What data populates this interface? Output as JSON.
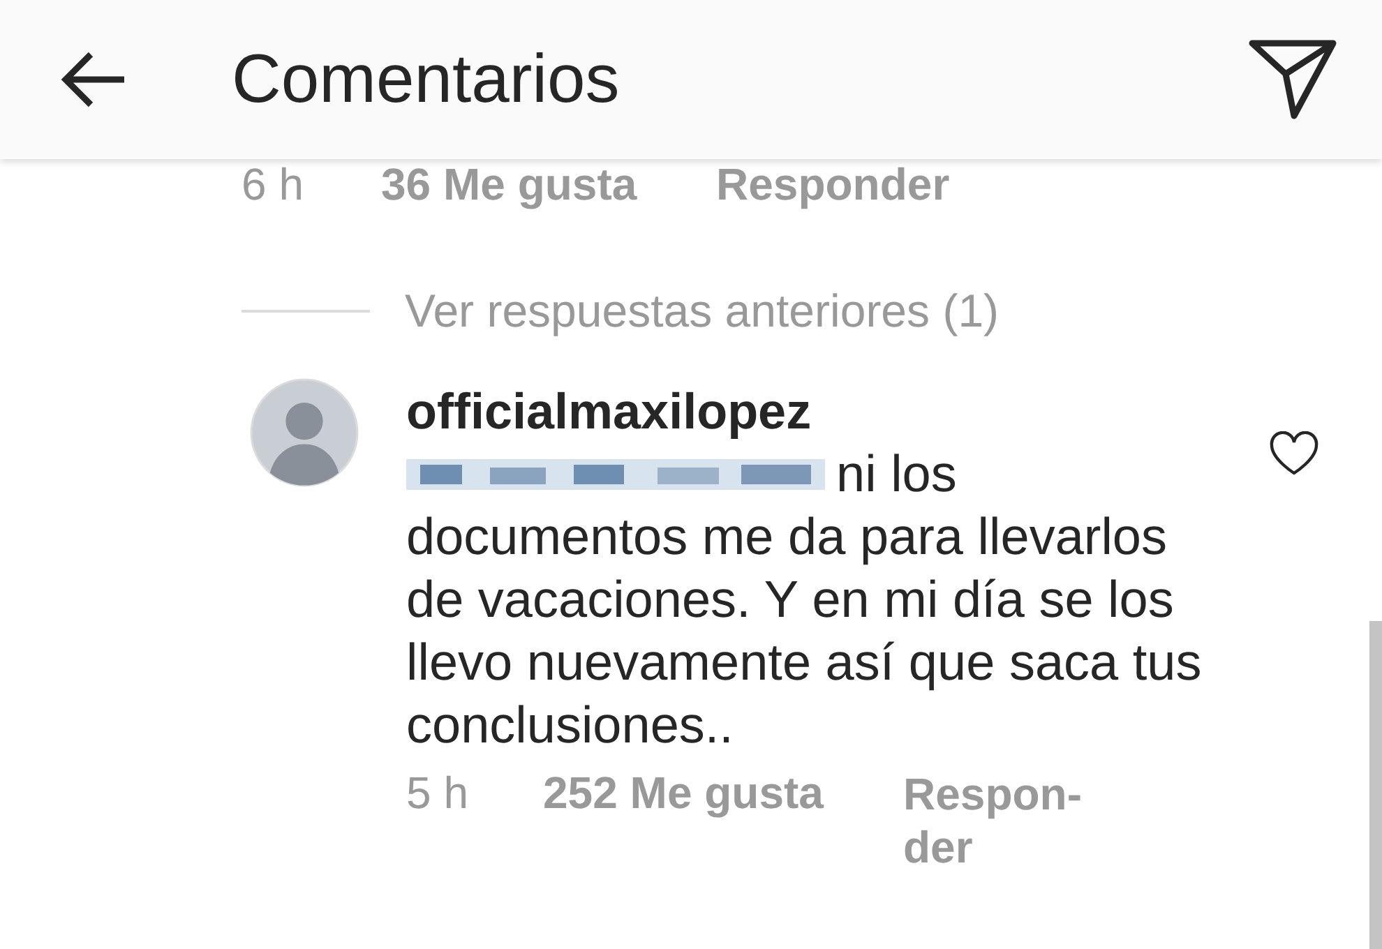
{
  "header": {
    "title": "Comentarios"
  },
  "previous_comment": {
    "time": "6 h",
    "likes": "36 Me gusta",
    "reply": "Responder"
  },
  "view_replies": "Ver respuestas anteriores (1)",
  "comment": {
    "username": "officialmaxilopez",
    "text_start": "ni los",
    "text": "documentos me da para llevarlos de vacaciones. Y en mi día se los llevo nuevamente así que saca tus conclusiones..",
    "liked": false,
    "time": "5 h",
    "likes": "252 Me gusta",
    "reply": "Respon-der"
  }
}
